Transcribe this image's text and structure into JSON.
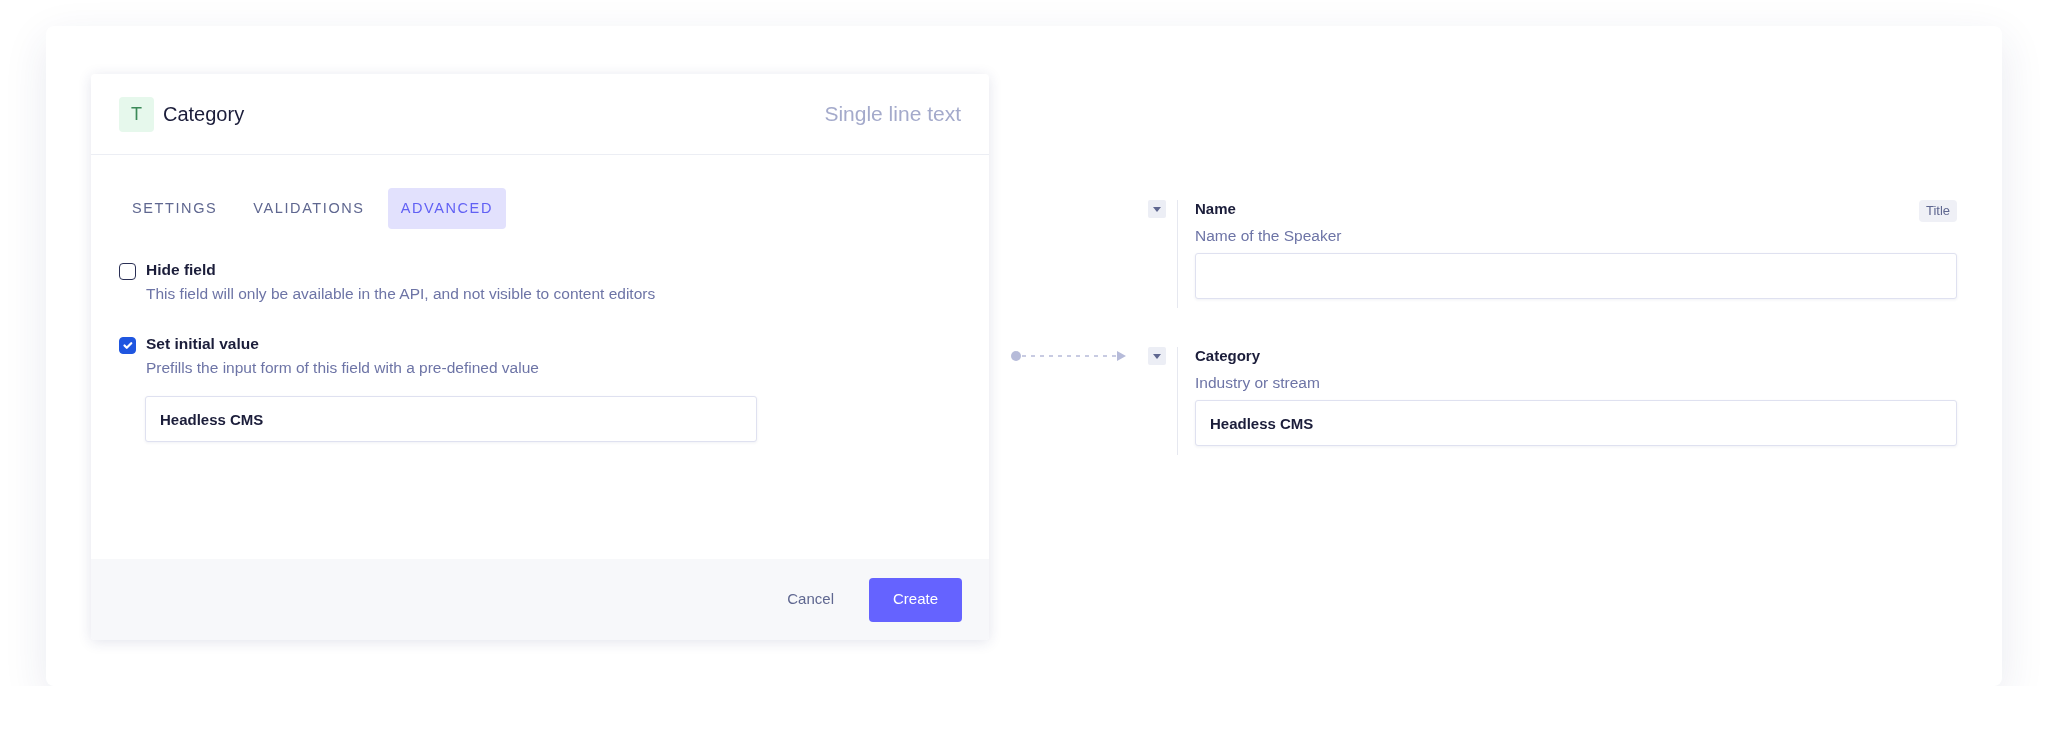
{
  "editor": {
    "type_icon": "T",
    "title": "Category",
    "type_label": "Single line text",
    "tabs": [
      {
        "label": "SETTINGS",
        "selected": false
      },
      {
        "label": "VALIDATIONS",
        "selected": false
      },
      {
        "label": "ADVANCED",
        "selected": true
      }
    ],
    "options": [
      {
        "label": "Hide field",
        "description": "This field will only be available in the API, and not visible to content editors",
        "checked": false
      },
      {
        "label": "Set initial value",
        "description": "Prefills the input form of this field with a pre-defined value",
        "checked": true,
        "value": "Headless CMS"
      }
    ],
    "buttons": [
      {
        "label": "Cancel",
        "kind": "link"
      },
      {
        "label": "Create",
        "kind": "primary"
      }
    ]
  },
  "preview": {
    "fields": [
      {
        "label": "Name",
        "description": "Name of the Speaker",
        "badge": "Title",
        "linked": false
      },
      {
        "label": "Category",
        "description": "Industry or stream",
        "value": "Headless CMS",
        "linked": true
      }
    ]
  }
}
